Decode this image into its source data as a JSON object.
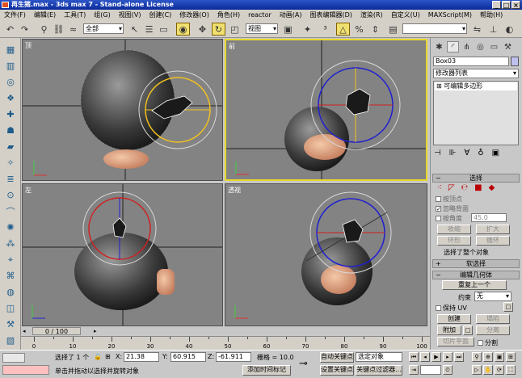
{
  "window": {
    "title": "再生猪.max - 3ds max 7 - Stand-alone License",
    "buttons": [
      "_",
      "□",
      "×"
    ]
  },
  "menu": [
    "文件(F)",
    "编辑(E)",
    "工具(T)",
    "组(G)",
    "视图(V)",
    "创建(C)",
    "修改器(O)",
    "角色(H)",
    "reactor",
    "动画(A)",
    "图表编辑器(D)",
    "渲染(R)",
    "自定义(U)",
    "MAXScript(M)",
    "帮助(H)"
  ],
  "toolbar": {
    "selection_filter": "全部",
    "ref_coord": "视图"
  },
  "viewports": {
    "top": "顶",
    "front": "前",
    "left": "左",
    "persp": "透视"
  },
  "command_panel": {
    "object_name": "Box03",
    "modifier_list": "修改器列表",
    "stack_item": "可编辑多边形",
    "selection": {
      "title": "选择",
      "by_vertex": "按顶点",
      "ignore_backfacing": "忽略背面",
      "by_angle": "按角度",
      "angle_value": "45.0",
      "shrink": "收缩",
      "grow": "扩大",
      "ring": "环形",
      "loop": "循环",
      "status": "选择了整个对象"
    },
    "soft_selection": "软选择",
    "edit_geometry": {
      "title": "编辑几何体",
      "repeat_last": "重复上一个",
      "constraints_label": "约束",
      "constraints_value": "无",
      "preserve_uv": "保持 UV",
      "create": "创建",
      "collapse": "塌陷",
      "attach": "附加",
      "detach": "分离",
      "slice_plane": "切片平面",
      "split": "分割"
    }
  },
  "timeline": {
    "frame": "0 / 100",
    "ticks": [
      "0",
      "10",
      "20",
      "30",
      "40",
      "50",
      "60",
      "70",
      "80",
      "90",
      "100"
    ]
  },
  "status": {
    "selected": "选择了 1 个",
    "x_label": "X:",
    "x": "21.38",
    "y_label": "Y:",
    "y": "60.915",
    "z_label": "Z:",
    "z": "-61.911",
    "grid": "栅格 = 10.0",
    "prompt": "单击并拖动以选择并旋转对象",
    "add_time_tag": "添加时间标记",
    "auto_key": "自动关键点",
    "set_key": "设置关键点",
    "selected_object": "选定对象",
    "key_filters": "关键点过滤器..."
  }
}
